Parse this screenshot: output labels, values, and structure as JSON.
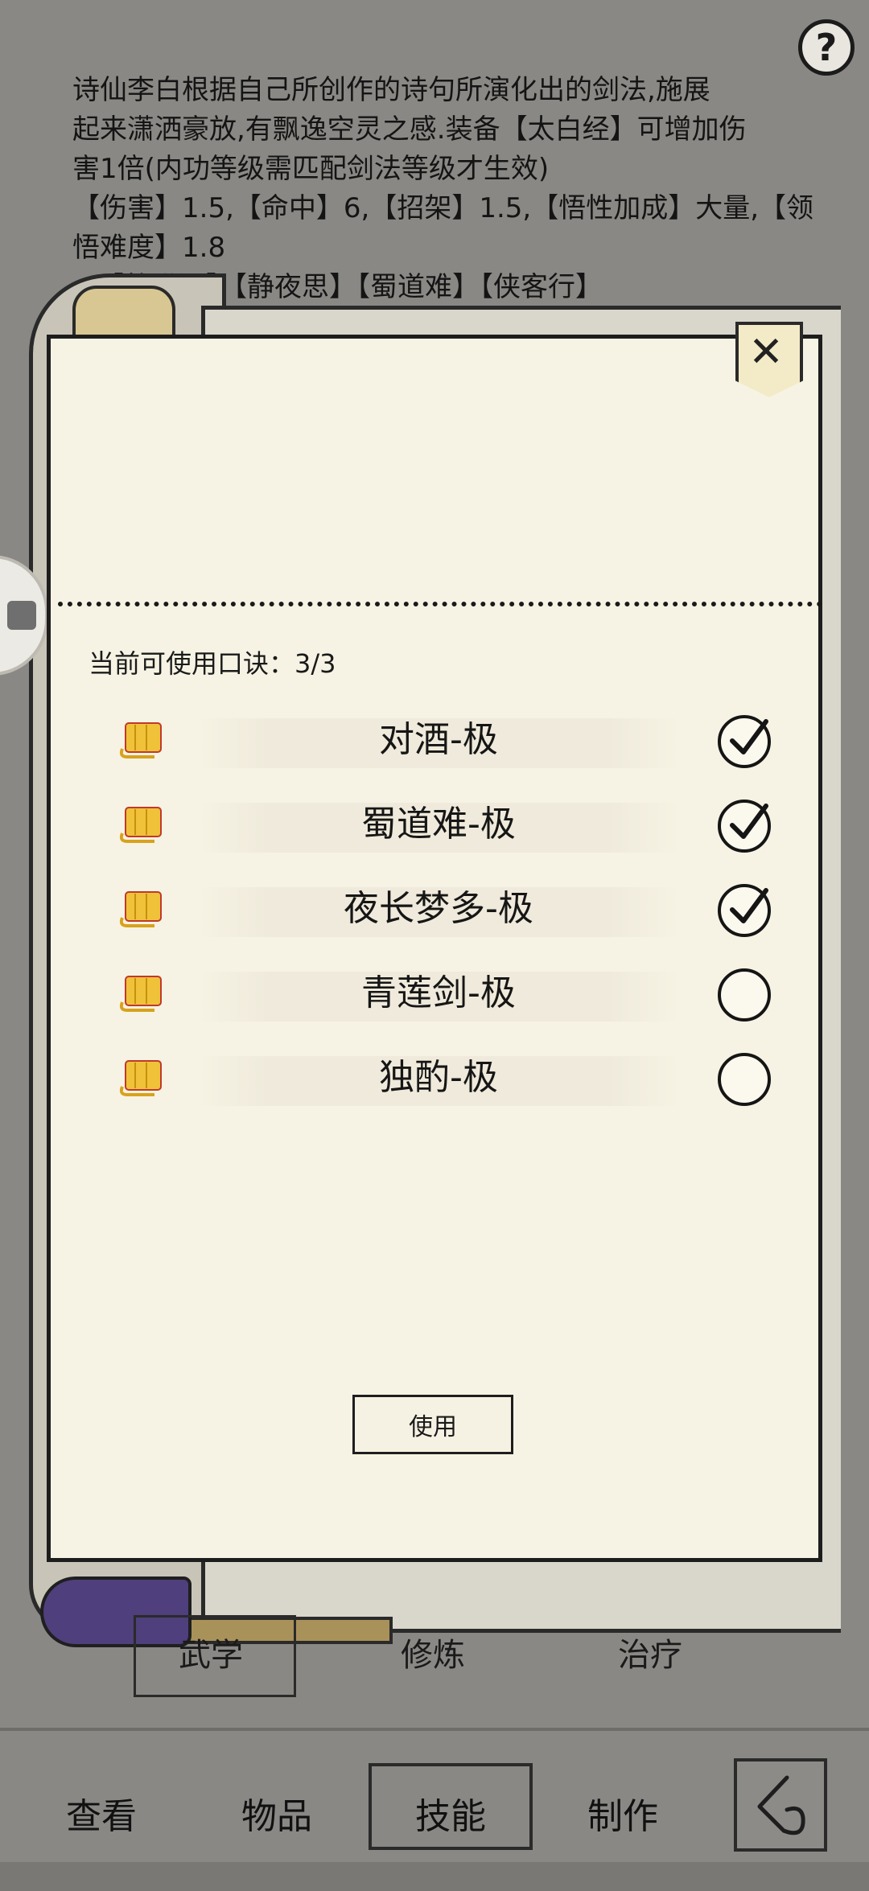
{
  "description": {
    "line1": "诗仙李白根据自己所创作的诗句所演化出的剑法,施展",
    "line2": "起来潇洒豪放,有飘逸空灵之感.装备【太白经】可增加伤",
    "line3": "害1倍(内功等级需匹配剑法等级才生效)",
    "line4": "【伤害】1.5,【命中】6,【招架】1.5,【悟性加成】大量,【领",
    "line5": "悟难度】1.8",
    "line6": "【将进酒】【静夜思】【蜀道难】【侠客行】"
  },
  "help": {
    "icon": "question-icon",
    "label": "?"
  },
  "panel": {
    "close_label": "✕",
    "count_label": "当前可使用口诀：3/3",
    "items": [
      {
        "label": "对酒-极",
        "checked": true
      },
      {
        "label": "蜀道难-极",
        "checked": true
      },
      {
        "label": "夜长梦多-极",
        "checked": true
      },
      {
        "label": "青莲剑-极",
        "checked": false
      },
      {
        "label": "独酌-极",
        "checked": false
      }
    ],
    "use_label": "使用"
  },
  "subtabs": {
    "martial": "武学",
    "cultivate": "修炼",
    "heal": "治疗"
  },
  "nav": {
    "view": "查看",
    "items": "物品",
    "skills": "技能",
    "craft": "制作"
  },
  "colors": {
    "paper": "#f7f3e4",
    "background": "#8a8885",
    "scroll_icon": "#f0c23a"
  }
}
